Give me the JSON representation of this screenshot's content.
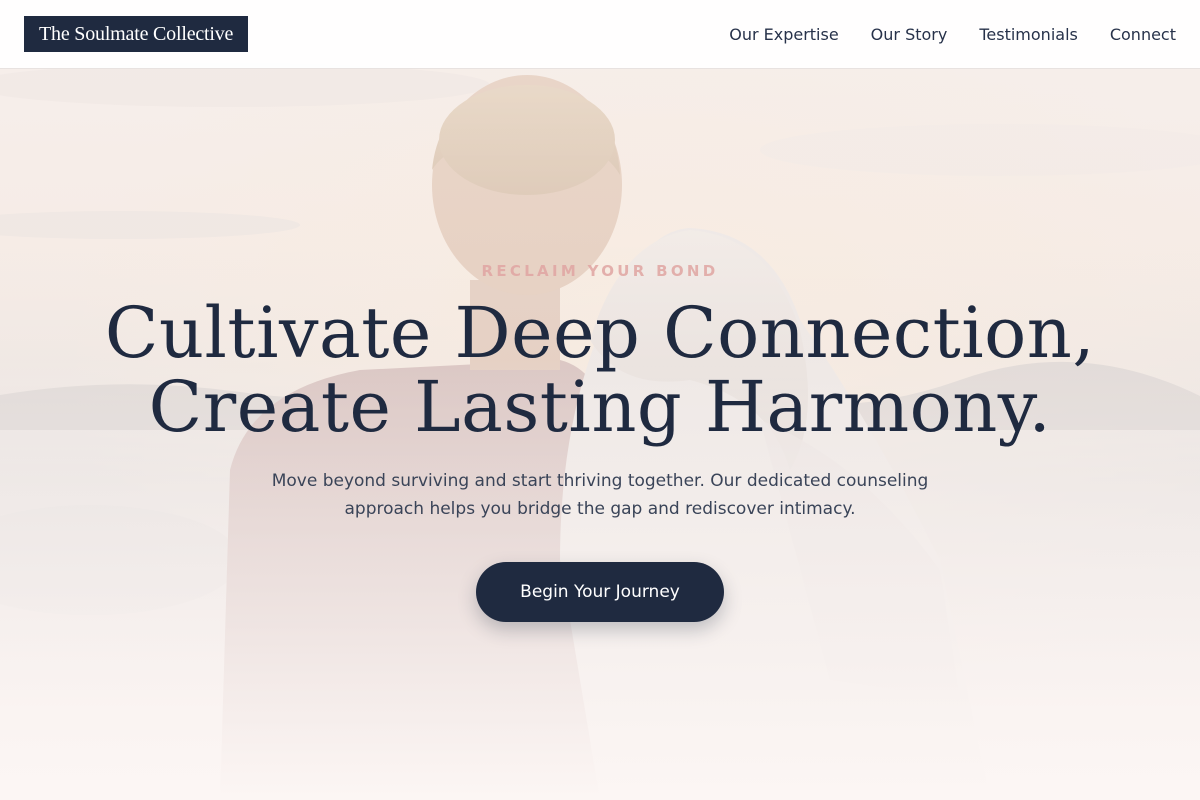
{
  "brand": {
    "name": "The Soulmate Collective"
  },
  "nav": {
    "links": [
      {
        "label": "Our Expertise"
      },
      {
        "label": "Our Story"
      },
      {
        "label": "Testimonials"
      },
      {
        "label": "Connect"
      }
    ]
  },
  "hero": {
    "eyebrow": "RECLAIM YOUR BOND",
    "headline_line1": "Cultivate Deep Connection,",
    "headline_line2": "Create Lasting Harmony.",
    "subtext": "Move beyond surviving and start thriving together. Our dedicated counseling approach helps you bridge the gap and rediscover intimacy.",
    "cta_label": "Begin Your Journey",
    "photo_icon": "couple-embracing-photo"
  },
  "colors": {
    "brand_navy": "#1f2a40",
    "eyebrow_rose": "#e0a5a2",
    "page_bg": "#fbf4f2",
    "body_text": "#3a4458"
  }
}
